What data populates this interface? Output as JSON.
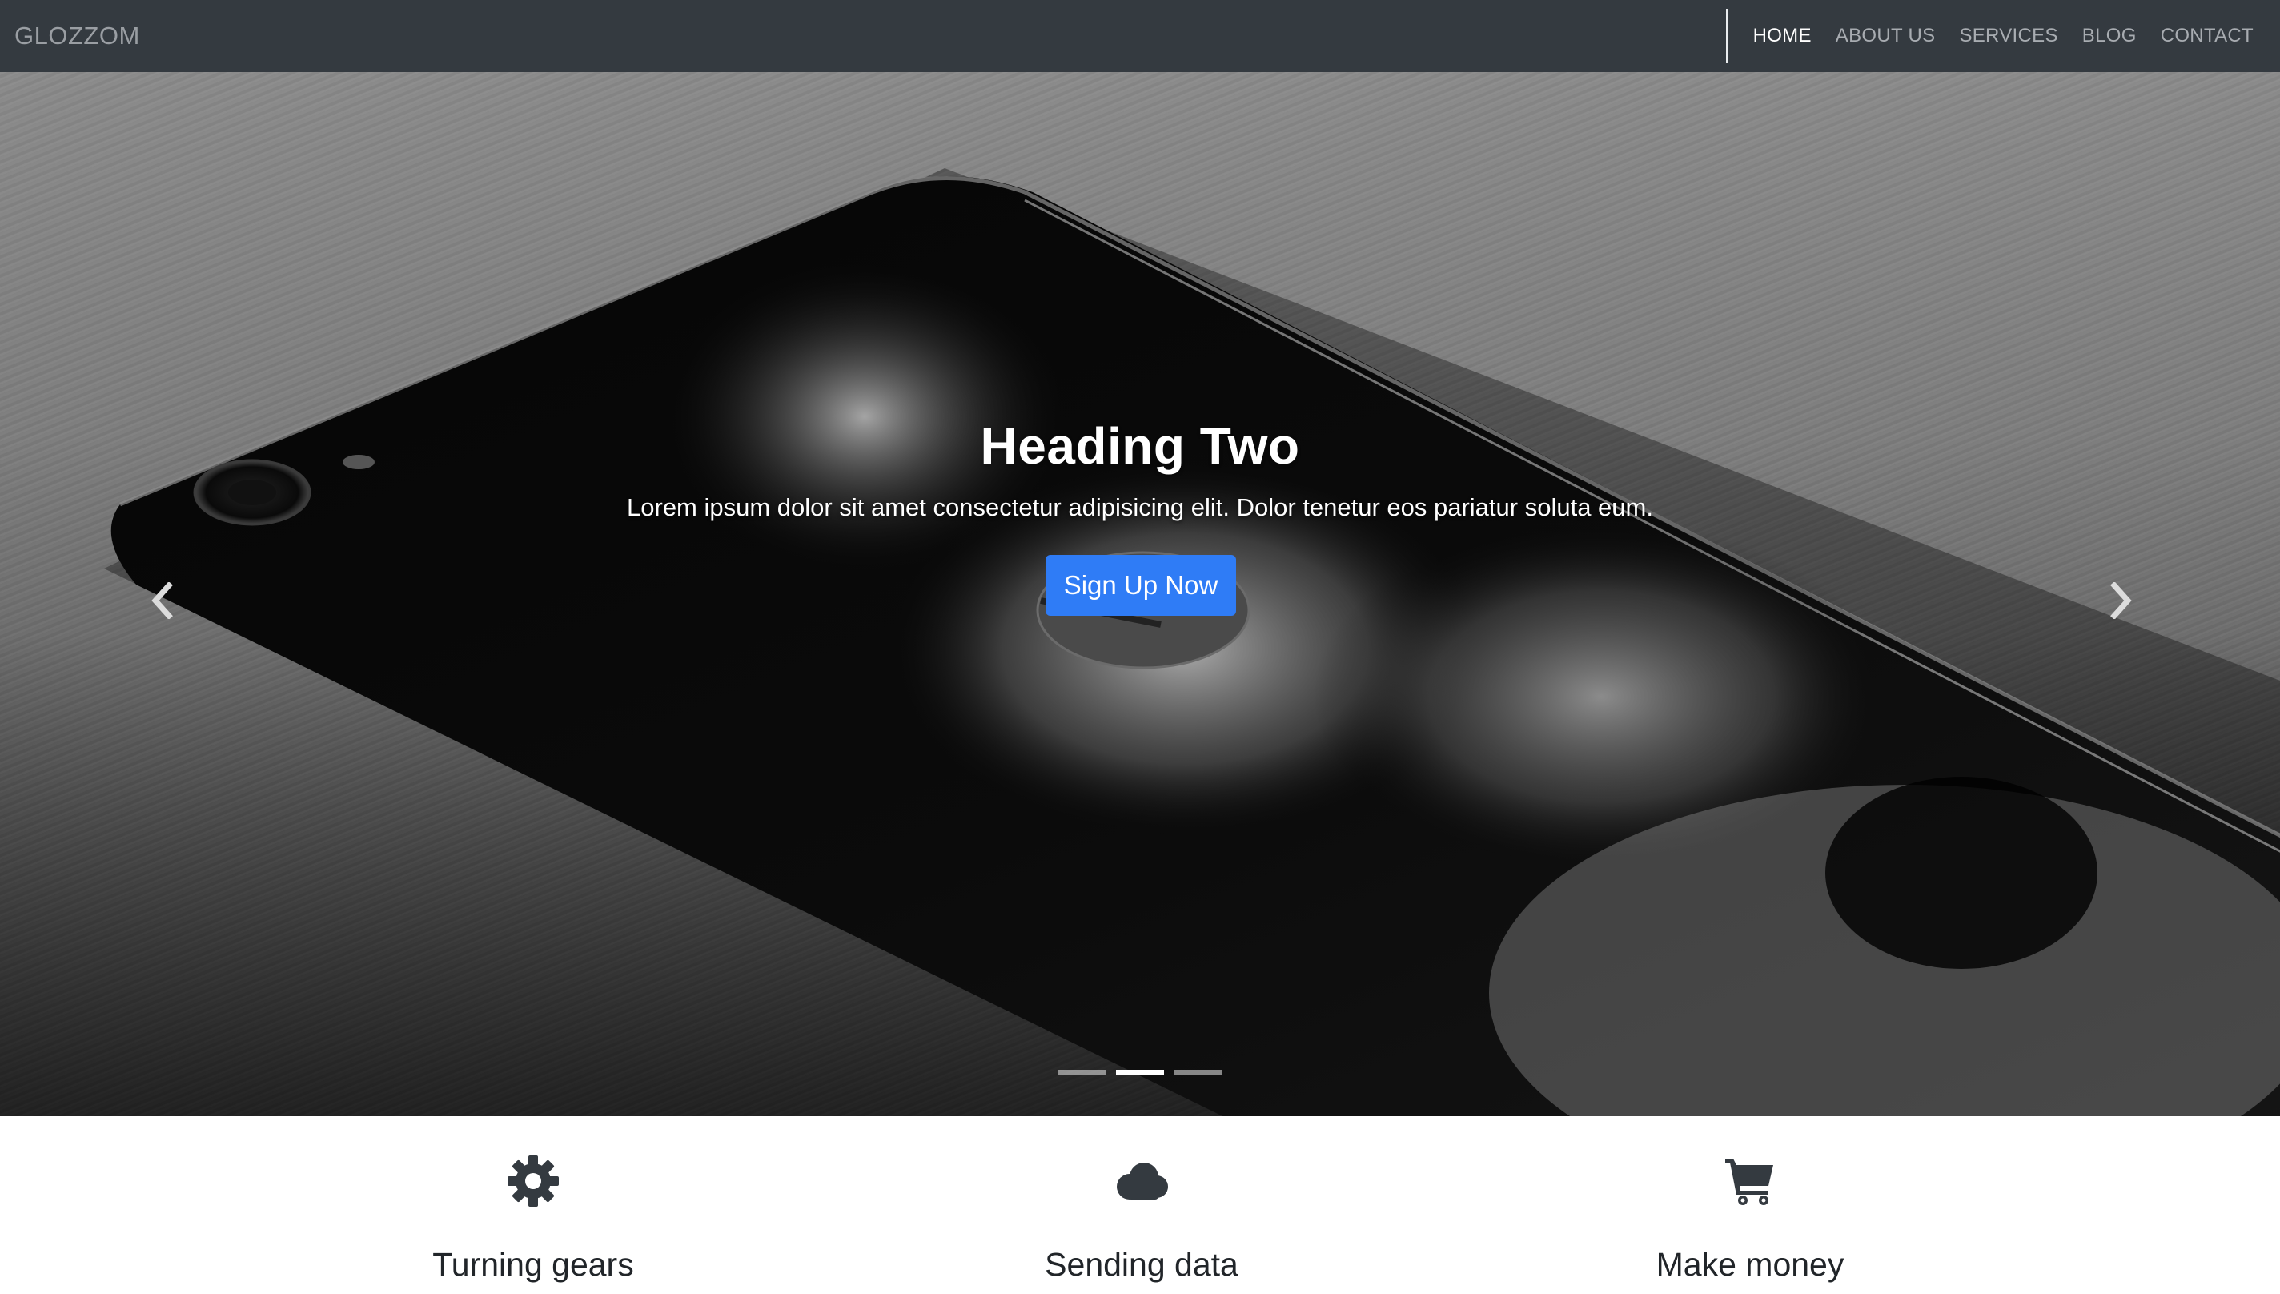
{
  "navbar": {
    "brand": "GLOZZOM",
    "links": [
      "HOME",
      "ABOUT US",
      "SERVICES",
      "BLOG",
      "CONTACT"
    ],
    "active_link": "HOME"
  },
  "carousel": {
    "heading": "Heading Two",
    "text": "Lorem ipsum dolor sit amet consectetur adipisicing elit. Dolor tenetur eos pariatur soluta eum.",
    "button_label": "Sign Up Now",
    "prev_icon": "chevron-left-icon",
    "next_icon": "chevron-right-icon",
    "slide_count": 3,
    "active_slide": 2
  },
  "features": [
    {
      "icon": "gear-icon",
      "title": "Turning gears"
    },
    {
      "icon": "cloud-icon",
      "title": "Sending data"
    },
    {
      "icon": "shopping-cart-icon",
      "title": "Make money"
    }
  ],
  "colors": {
    "navbar_bg": "#343a40",
    "nav_active": "#ffffff",
    "nav_inactive": "#a8acb1",
    "primary_button": "#2f7cf6",
    "feature_text": "#212529"
  }
}
